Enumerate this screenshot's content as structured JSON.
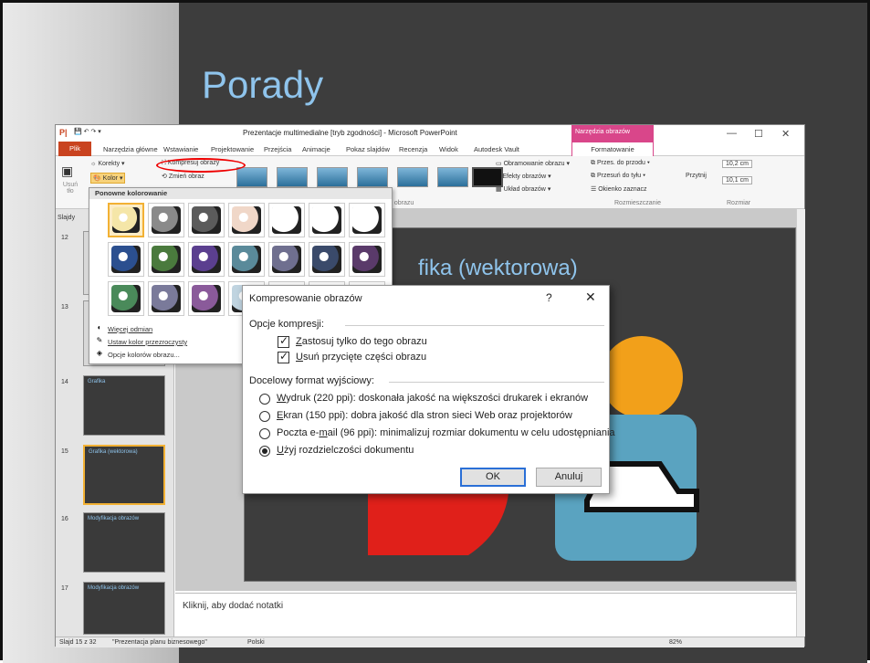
{
  "slide": {
    "title": "Porady"
  },
  "window": {
    "title": "Prezentacje multimedialne [tryb zgodności] - Microsoft PowerPoint",
    "context_tab_group": "Narzędzia obrazów",
    "file_tab": "Plik",
    "tabs": [
      "Narzędzia główne",
      "Wstawianie",
      "Projektowanie",
      "Przejścia",
      "Animacje",
      "Pokaz slajdów",
      "Recenzja",
      "Widok",
      "Autodesk Vault"
    ],
    "format_tab": "Formatowanie",
    "minimize": "—",
    "maximize": "☐",
    "close": "✕"
  },
  "ribbon": {
    "remove_bg": "Usuń tło",
    "corrections": "Korekty",
    "color": "Kolor",
    "compress": "Kompresuj obrazy",
    "change_picture": "Zmień obraz",
    "picture_styles_label": "yle obrazu",
    "border": "Obramowanie obrazu",
    "effects": "Efekty obrazów",
    "layout": "Układ obrazów",
    "bring_forward": "Przes. do przodu",
    "send_backward": "Przesuń do tyłu",
    "selection_pane": "Okienko zaznacz",
    "arrange_label": "Rozmieszczanie",
    "crop": "Przytnij",
    "height": "10,2 cm",
    "width": "10,1 cm",
    "size_label": "Rozmiar"
  },
  "recolor": {
    "header": "Ponowne kolorowanie",
    "swatch_colors": [
      "#f5e6a8",
      "#8a8a8a",
      "#5b5b5b",
      "#f0d7c8",
      "#ffffff",
      "#ffffff",
      "#ffffff",
      "#2b4f8f",
      "#4a7a3d",
      "#5b3f8f",
      "#5a8a9a",
      "#6f6f8f",
      "#3a4a6a",
      "#5a3a6a",
      "#4a8a5a",
      "#7a7a9a",
      "#8a5a9a",
      "#c0d4e0",
      "#dfe9ef",
      "#d0d8e0",
      "#eaeaea"
    ],
    "more_variations": "Więcej odmian",
    "set_transparent": "Ustaw kolor przezroczysty",
    "color_options": "Opcje kolorów obrazu..."
  },
  "panel": {
    "slides_label": "Slajdy",
    "slide_numbers": [
      "12",
      "13",
      "14",
      "15",
      "16",
      "17"
    ],
    "thumb_titles": [
      "Grafika",
      "Grafika (wektorowa)",
      "Modyfikacja obrazów",
      "Modyfikacja obrazów"
    ]
  },
  "main_slide": {
    "heading": "fika (wektorowa)"
  },
  "notes": {
    "placeholder": "Kliknij, aby dodać notatki"
  },
  "status": {
    "slide_info": "Slajd 15 z 32",
    "theme": "\"Prezentacja planu biznesowego\"",
    "language": "Polski",
    "zoom": "82%"
  },
  "dialog": {
    "title": "Kompresowanie obrazów",
    "help": "?",
    "close": "✕",
    "group1": "Opcje kompresji:",
    "opt_apply_first": "Z",
    "opt_apply_rest": "astosuj tylko do tego obrazu",
    "opt_delete_first": "U",
    "opt_delete_rest": "suń przycięte części obrazu",
    "group2": "Docelowy format wyjściowy:",
    "print_first": "W",
    "print_rest": "ydruk (220 ppi): doskonała jakość na większości drukarek i ekranów",
    "screen_first": "E",
    "screen_rest": "kran (150 ppi): dobra jakość dla stron sieci Web oraz projektorów",
    "email_a": "Poczta e-",
    "email_u": "m",
    "email_b": "ail (96 ppi): minimalizuj rozmiar dokumentu w celu udostępniania",
    "doc_first": "U",
    "doc_rest": "żyj rozdzielczości dokumentu",
    "ok": "OK",
    "cancel": "Anuluj"
  }
}
